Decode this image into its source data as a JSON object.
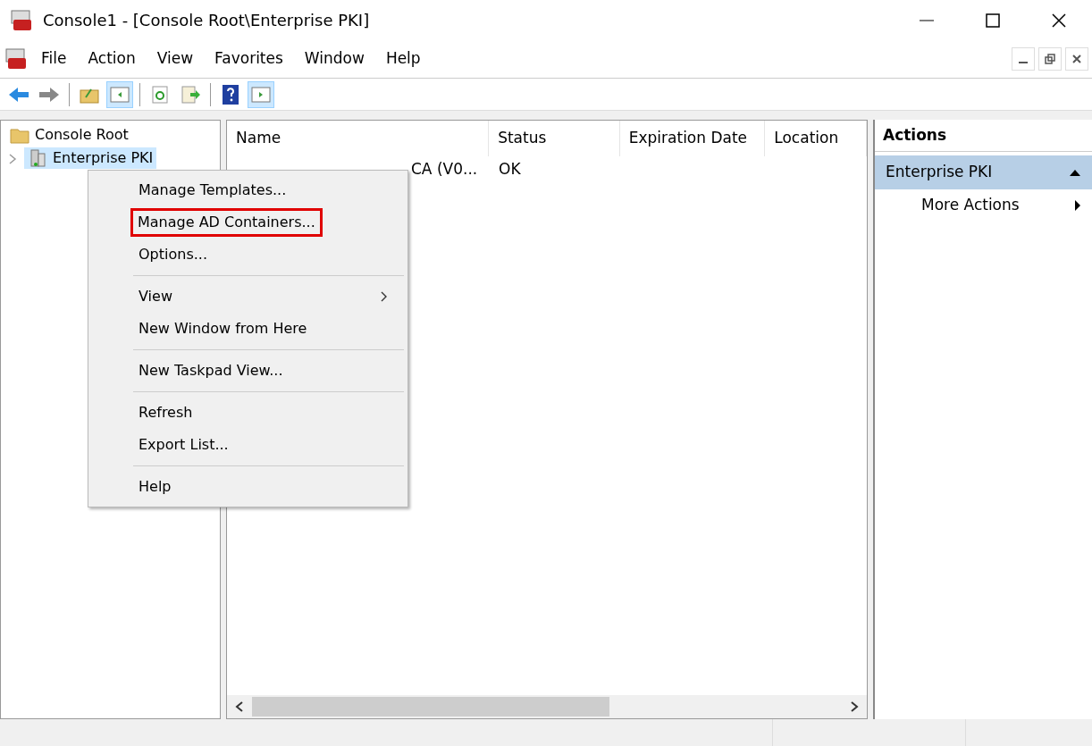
{
  "window": {
    "title": "Console1 - [Console Root\\Enterprise PKI]"
  },
  "menu_bar": [
    "File",
    "Action",
    "View",
    "Favorites",
    "Window",
    "Help"
  ],
  "tree": [
    {
      "label": "Console Root",
      "selected": false,
      "children": [
        {
          "label": "Enterprise PKI",
          "selected": true,
          "expanded": false
        }
      ]
    }
  ],
  "table": {
    "columns": [
      "Name",
      "Status",
      "Expiration Date",
      "Location"
    ],
    "rows": [
      {
        "name": "CA (V0...",
        "status": "OK"
      }
    ]
  },
  "context_menu": {
    "items": [
      {
        "kind": "item",
        "label": "Manage Templates...",
        "highlighted": false,
        "submenu": false
      },
      {
        "kind": "item",
        "label": "Manage AD Containers...",
        "highlighted": true,
        "submenu": false
      },
      {
        "kind": "item",
        "label": "Options...",
        "highlighted": false,
        "submenu": false
      },
      {
        "kind": "separator"
      },
      {
        "kind": "item",
        "label": "View",
        "highlighted": false,
        "submenu": true
      },
      {
        "kind": "item",
        "label": "New Window from Here",
        "highlighted": false,
        "submenu": false
      },
      {
        "kind": "separator"
      },
      {
        "kind": "item",
        "label": "New Taskpad View...",
        "highlighted": false,
        "submenu": false
      },
      {
        "kind": "separator"
      },
      {
        "kind": "item",
        "label": "Refresh",
        "highlighted": false,
        "submenu": false
      },
      {
        "kind": "item",
        "label": "Export List...",
        "highlighted": false,
        "submenu": false
      },
      {
        "kind": "separator"
      },
      {
        "kind": "item",
        "label": "Help",
        "highlighted": false,
        "submenu": false
      }
    ]
  },
  "actions_pane": {
    "title": "Actions",
    "section": "Enterprise PKI",
    "items": [
      "More Actions"
    ]
  }
}
